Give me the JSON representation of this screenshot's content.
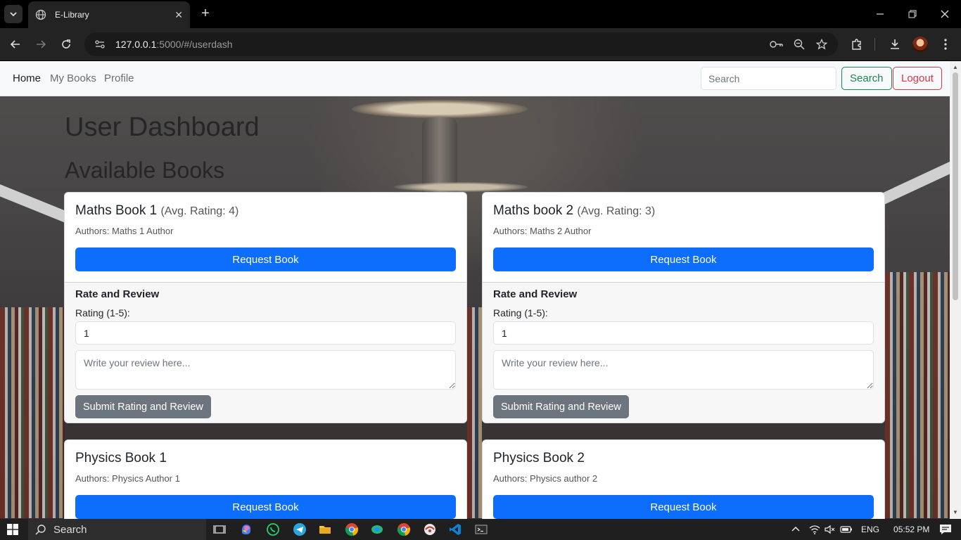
{
  "browser": {
    "tab_title": "E-Library",
    "url_host": "127.0.0.1",
    "url_rest": ":5000/#/userdash"
  },
  "nav": {
    "links": [
      "Home",
      "My Books",
      "Profile"
    ],
    "search_placeholder": "Search",
    "search_button": "Search",
    "logout_button": "Logout"
  },
  "page": {
    "title": "User Dashboard",
    "section_title": "Available Books"
  },
  "books": [
    {
      "title": "Maths Book 1",
      "rating_text": "(Avg. Rating: 4)",
      "authors": "Authors: Maths 1 Author",
      "request_label": "Request Book",
      "review": {
        "heading": "Rate and Review",
        "rating_label": "Rating (1-5):",
        "rating_value": "1",
        "review_placeholder": "Write your review here...",
        "submit_label": "Submit Rating and Review"
      }
    },
    {
      "title": "Maths book 2",
      "rating_text": "(Avg. Rating: 3)",
      "authors": "Authors: Maths 2 Author",
      "request_label": "Request Book",
      "review": {
        "heading": "Rate and Review",
        "rating_label": "Rating (1-5):",
        "rating_value": "1",
        "review_placeholder": "Write your review here...",
        "submit_label": "Submit Rating and Review"
      }
    },
    {
      "title": "Physics Book 1",
      "authors": "Authors: Physics Author 1",
      "request_label": "Request Book"
    },
    {
      "title": "Physics Book 2",
      "authors": "Authors: Physics author 2",
      "request_label": "Request Book"
    }
  ],
  "taskbar": {
    "search_text": "Search",
    "language": "ENG",
    "time": "05:52 PM"
  },
  "colors": {
    "primary": "#0d6efd",
    "success": "#198754",
    "danger": "#dc3545",
    "secondary": "#6c757d"
  }
}
